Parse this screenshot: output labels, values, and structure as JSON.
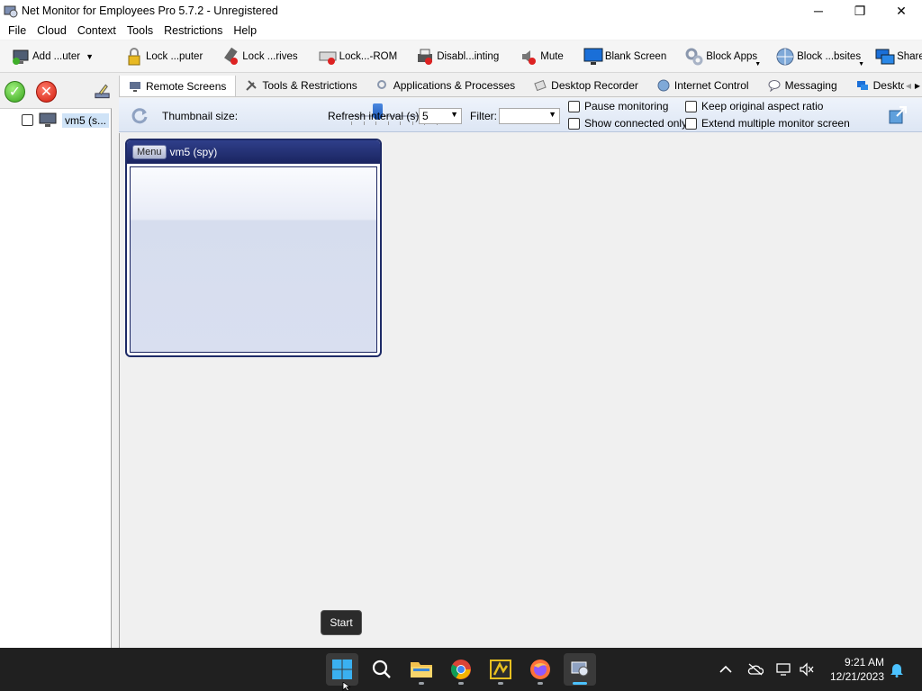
{
  "window": {
    "title": "Net Monitor for Employees Pro 5.7.2 - Unregistered",
    "controls": {
      "minimize": "─",
      "maximize": "❐",
      "close": "✕"
    }
  },
  "menu": [
    "File",
    "Cloud",
    "Context",
    "Tools",
    "Restrictions",
    "Help"
  ],
  "toolbar": {
    "add_computer": "Add ...uter",
    "lock_computer": "Lock ...puter",
    "lock_drives": "Lock ...rives",
    "lock_cdrom": "Lock...-ROM",
    "disable_printing": "Disabl...inting",
    "mute": "Mute",
    "blank_screen": "Blank Screen",
    "block_apps": "Block Apps",
    "block_websites": "Block ...bsites",
    "share_desktop": "Share...sktop"
  },
  "tree": {
    "item_label": "vm5 (s..."
  },
  "tabs": [
    "Remote Screens",
    "Tools & Restrictions",
    "Applications & Processes",
    "Desktop Recorder",
    "Internet Control",
    "Messaging",
    "Desktop Shar"
  ],
  "options": {
    "thumbnail_size_label": "Thumbnail size:",
    "thumbnail_size_value": 0.3,
    "refresh_interval_label": "Refresh interval (s):",
    "refresh_interval_value": "5",
    "filter_label": "Filter:",
    "filter_value": "",
    "pause_monitoring": "Pause monitoring",
    "show_connected_only": "Show connected only",
    "keep_aspect_ratio": "Keep original aspect ratio",
    "extend_multiple_monitor": "Extend multiple monitor screen"
  },
  "thumbnail": {
    "menu_label": "Menu",
    "title": "vm5 (spy)"
  },
  "tooltip": {
    "text": "Start"
  },
  "taskbar": {
    "apps": [
      "start-icon",
      "search-icon",
      "file-explorer-icon",
      "chrome-icon",
      "app-icon",
      "firefox-icon",
      "net-monitor-icon"
    ],
    "time": "9:21 AM",
    "date": "12/21/2023"
  },
  "colors": {
    "thumb_header": "#1d2a66",
    "taskbar": "#202020",
    "accent": "#4cc2ff"
  }
}
